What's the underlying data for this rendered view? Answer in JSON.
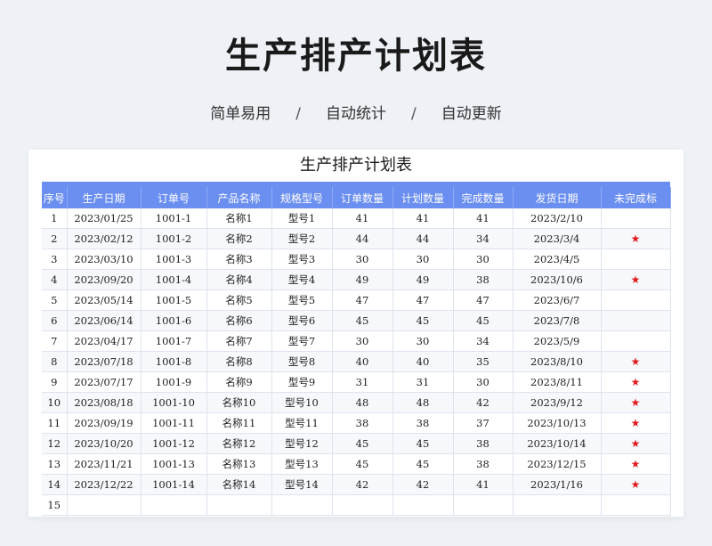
{
  "hero": {
    "title": "生产排产计划表",
    "subtitle_items": [
      "简单易用",
      "自动统计",
      "自动更新"
    ],
    "separator": "/"
  },
  "sheet": {
    "title": "生产排产计划表",
    "columns": [
      "序号",
      "生产日期",
      "订单号",
      "产品名称",
      "规格型号",
      "订单数量",
      "计划数量",
      "完成数量",
      "发货日期",
      "未完成标"
    ],
    "rows": [
      [
        "1",
        "2023/01/25",
        "1001-1",
        "名称1",
        "型号1",
        "41",
        "41",
        "41",
        "2023/2/10",
        ""
      ],
      [
        "2",
        "2023/02/12",
        "1001-2",
        "名称2",
        "型号2",
        "44",
        "44",
        "34",
        "2023/3/4",
        "★"
      ],
      [
        "3",
        "2023/03/10",
        "1001-3",
        "名称3",
        "型号3",
        "30",
        "30",
        "30",
        "2023/4/5",
        ""
      ],
      [
        "4",
        "2023/09/20",
        "1001-4",
        "名称4",
        "型号4",
        "49",
        "49",
        "38",
        "2023/10/6",
        "★"
      ],
      [
        "5",
        "2023/05/14",
        "1001-5",
        "名称5",
        "型号5",
        "47",
        "47",
        "47",
        "2023/6/7",
        ""
      ],
      [
        "6",
        "2023/06/14",
        "1001-6",
        "名称6",
        "型号6",
        "45",
        "45",
        "45",
        "2023/7/8",
        ""
      ],
      [
        "7",
        "2023/04/17",
        "1001-7",
        "名称7",
        "型号7",
        "30",
        "30",
        "34",
        "2023/5/9",
        ""
      ],
      [
        "8",
        "2023/07/18",
        "1001-8",
        "名称8",
        "型号8",
        "40",
        "40",
        "35",
        "2023/8/10",
        "★"
      ],
      [
        "9",
        "2023/07/17",
        "1001-9",
        "名称9",
        "型号9",
        "31",
        "31",
        "30",
        "2023/8/11",
        "★"
      ],
      [
        "10",
        "2023/08/18",
        "1001-10",
        "名称10",
        "型号10",
        "48",
        "48",
        "42",
        "2023/9/12",
        "★"
      ],
      [
        "11",
        "2023/09/19",
        "1001-11",
        "名称11",
        "型号11",
        "38",
        "38",
        "37",
        "2023/10/13",
        "★"
      ],
      [
        "12",
        "2023/10/20",
        "1001-12",
        "名称12",
        "型号12",
        "45",
        "45",
        "38",
        "2023/10/14",
        "★"
      ],
      [
        "13",
        "2023/11/21",
        "1001-13",
        "名称13",
        "型号13",
        "45",
        "45",
        "38",
        "2023/12/15",
        "★"
      ],
      [
        "14",
        "2023/12/22",
        "1001-14",
        "名称14",
        "型号14",
        "42",
        "42",
        "41",
        "2023/1/16",
        "★"
      ],
      [
        "15",
        "",
        "",
        "",
        "",
        "",
        "",
        "",
        "",
        ""
      ]
    ]
  }
}
